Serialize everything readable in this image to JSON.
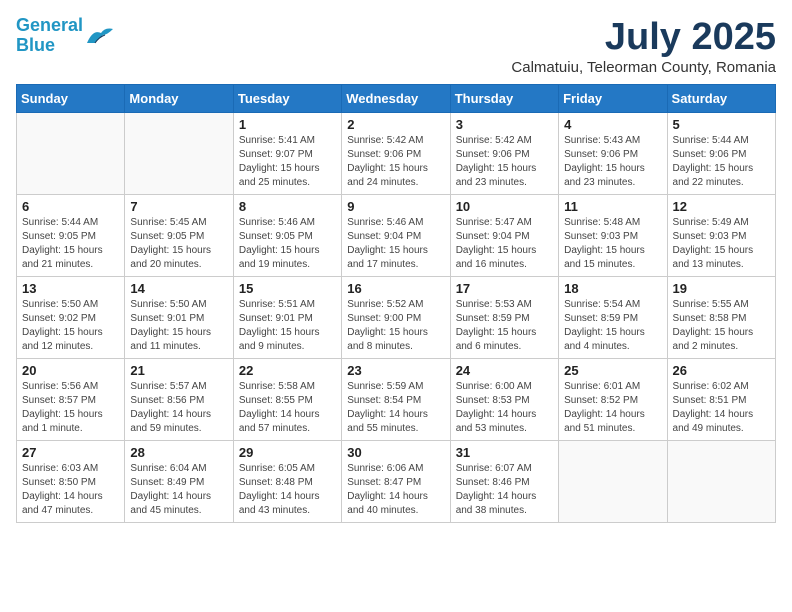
{
  "logo": {
    "line1": "General",
    "line2": "Blue"
  },
  "title": "July 2025",
  "subtitle": "Calmatuiu, Teleorman County, Romania",
  "days_header": [
    "Sunday",
    "Monday",
    "Tuesday",
    "Wednesday",
    "Thursday",
    "Friday",
    "Saturday"
  ],
  "weeks": [
    [
      {
        "day": "",
        "info": ""
      },
      {
        "day": "",
        "info": ""
      },
      {
        "day": "1",
        "info": "Sunrise: 5:41 AM\nSunset: 9:07 PM\nDaylight: 15 hours\nand 25 minutes."
      },
      {
        "day": "2",
        "info": "Sunrise: 5:42 AM\nSunset: 9:06 PM\nDaylight: 15 hours\nand 24 minutes."
      },
      {
        "day": "3",
        "info": "Sunrise: 5:42 AM\nSunset: 9:06 PM\nDaylight: 15 hours\nand 23 minutes."
      },
      {
        "day": "4",
        "info": "Sunrise: 5:43 AM\nSunset: 9:06 PM\nDaylight: 15 hours\nand 23 minutes."
      },
      {
        "day": "5",
        "info": "Sunrise: 5:44 AM\nSunset: 9:06 PM\nDaylight: 15 hours\nand 22 minutes."
      }
    ],
    [
      {
        "day": "6",
        "info": "Sunrise: 5:44 AM\nSunset: 9:05 PM\nDaylight: 15 hours\nand 21 minutes."
      },
      {
        "day": "7",
        "info": "Sunrise: 5:45 AM\nSunset: 9:05 PM\nDaylight: 15 hours\nand 20 minutes."
      },
      {
        "day": "8",
        "info": "Sunrise: 5:46 AM\nSunset: 9:05 PM\nDaylight: 15 hours\nand 19 minutes."
      },
      {
        "day": "9",
        "info": "Sunrise: 5:46 AM\nSunset: 9:04 PM\nDaylight: 15 hours\nand 17 minutes."
      },
      {
        "day": "10",
        "info": "Sunrise: 5:47 AM\nSunset: 9:04 PM\nDaylight: 15 hours\nand 16 minutes."
      },
      {
        "day": "11",
        "info": "Sunrise: 5:48 AM\nSunset: 9:03 PM\nDaylight: 15 hours\nand 15 minutes."
      },
      {
        "day": "12",
        "info": "Sunrise: 5:49 AM\nSunset: 9:03 PM\nDaylight: 15 hours\nand 13 minutes."
      }
    ],
    [
      {
        "day": "13",
        "info": "Sunrise: 5:50 AM\nSunset: 9:02 PM\nDaylight: 15 hours\nand 12 minutes."
      },
      {
        "day": "14",
        "info": "Sunrise: 5:50 AM\nSunset: 9:01 PM\nDaylight: 15 hours\nand 11 minutes."
      },
      {
        "day": "15",
        "info": "Sunrise: 5:51 AM\nSunset: 9:01 PM\nDaylight: 15 hours\nand 9 minutes."
      },
      {
        "day": "16",
        "info": "Sunrise: 5:52 AM\nSunset: 9:00 PM\nDaylight: 15 hours\nand 8 minutes."
      },
      {
        "day": "17",
        "info": "Sunrise: 5:53 AM\nSunset: 8:59 PM\nDaylight: 15 hours\nand 6 minutes."
      },
      {
        "day": "18",
        "info": "Sunrise: 5:54 AM\nSunset: 8:59 PM\nDaylight: 15 hours\nand 4 minutes."
      },
      {
        "day": "19",
        "info": "Sunrise: 5:55 AM\nSunset: 8:58 PM\nDaylight: 15 hours\nand 2 minutes."
      }
    ],
    [
      {
        "day": "20",
        "info": "Sunrise: 5:56 AM\nSunset: 8:57 PM\nDaylight: 15 hours\nand 1 minute."
      },
      {
        "day": "21",
        "info": "Sunrise: 5:57 AM\nSunset: 8:56 PM\nDaylight: 14 hours\nand 59 minutes."
      },
      {
        "day": "22",
        "info": "Sunrise: 5:58 AM\nSunset: 8:55 PM\nDaylight: 14 hours\nand 57 minutes."
      },
      {
        "day": "23",
        "info": "Sunrise: 5:59 AM\nSunset: 8:54 PM\nDaylight: 14 hours\nand 55 minutes."
      },
      {
        "day": "24",
        "info": "Sunrise: 6:00 AM\nSunset: 8:53 PM\nDaylight: 14 hours\nand 53 minutes."
      },
      {
        "day": "25",
        "info": "Sunrise: 6:01 AM\nSunset: 8:52 PM\nDaylight: 14 hours\nand 51 minutes."
      },
      {
        "day": "26",
        "info": "Sunrise: 6:02 AM\nSunset: 8:51 PM\nDaylight: 14 hours\nand 49 minutes."
      }
    ],
    [
      {
        "day": "27",
        "info": "Sunrise: 6:03 AM\nSunset: 8:50 PM\nDaylight: 14 hours\nand 47 minutes."
      },
      {
        "day": "28",
        "info": "Sunrise: 6:04 AM\nSunset: 8:49 PM\nDaylight: 14 hours\nand 45 minutes."
      },
      {
        "day": "29",
        "info": "Sunrise: 6:05 AM\nSunset: 8:48 PM\nDaylight: 14 hours\nand 43 minutes."
      },
      {
        "day": "30",
        "info": "Sunrise: 6:06 AM\nSunset: 8:47 PM\nDaylight: 14 hours\nand 40 minutes."
      },
      {
        "day": "31",
        "info": "Sunrise: 6:07 AM\nSunset: 8:46 PM\nDaylight: 14 hours\nand 38 minutes."
      },
      {
        "day": "",
        "info": ""
      },
      {
        "day": "",
        "info": ""
      }
    ]
  ]
}
